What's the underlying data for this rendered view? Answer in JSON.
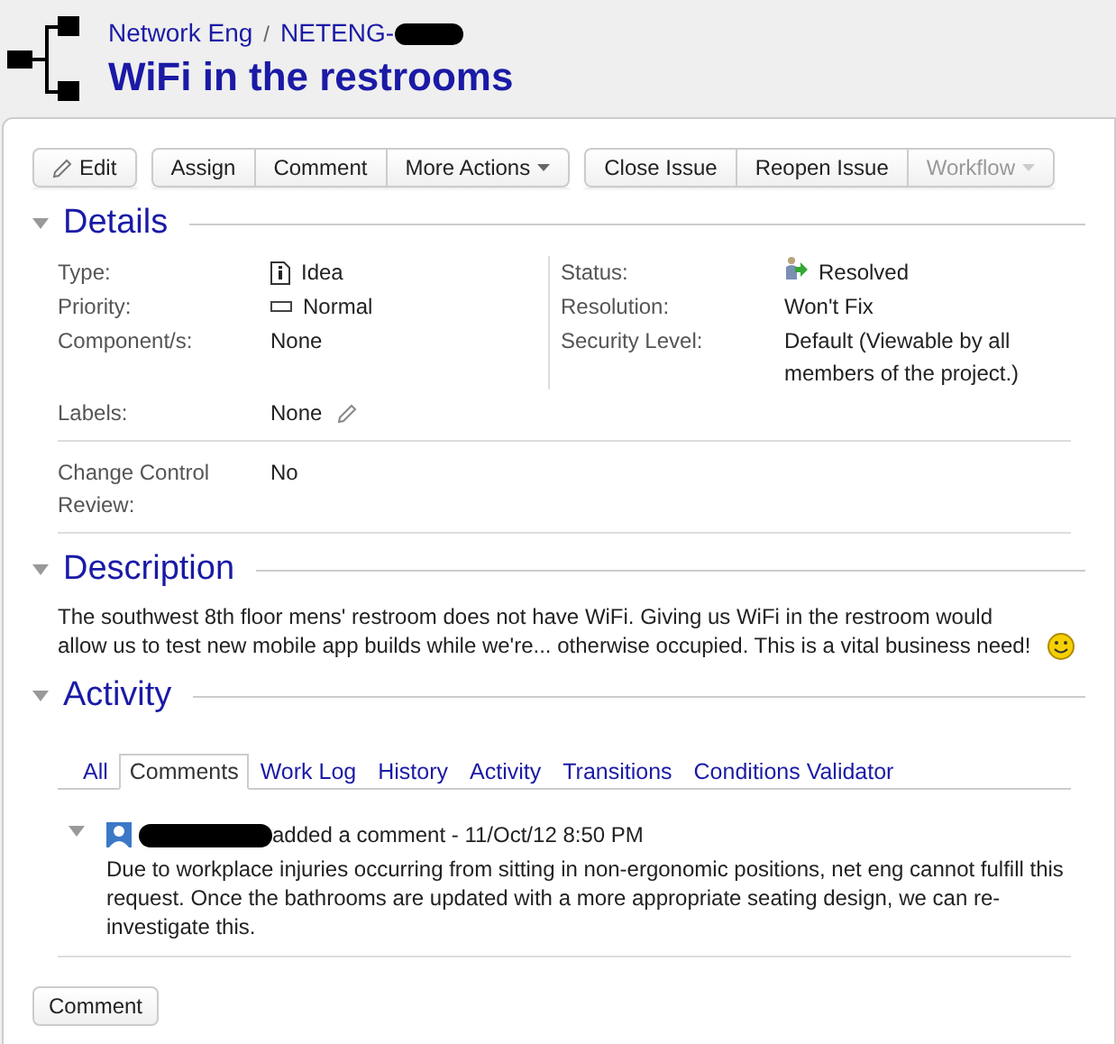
{
  "header": {
    "project": "Network Eng",
    "separator": "/",
    "issue_key": "NETENG-",
    "title": "WiFi in the restrooms"
  },
  "toolbar": [
    {
      "buttons": [
        {
          "label": "Edit",
          "kind": "edit",
          "disabled": false
        }
      ]
    },
    {
      "buttons": [
        {
          "label": "Assign",
          "kind": "plain",
          "disabled": false
        },
        {
          "label": "Comment",
          "kind": "plain",
          "disabled": false
        },
        {
          "label": "More Actions",
          "kind": "dropdown",
          "disabled": false
        }
      ]
    },
    {
      "buttons": [
        {
          "label": "Close Issue",
          "kind": "plain",
          "disabled": false
        },
        {
          "label": "Reopen Issue",
          "kind": "plain",
          "disabled": false
        },
        {
          "label": "Workflow",
          "kind": "dropdown",
          "disabled": true
        }
      ]
    }
  ],
  "details": {
    "title": "Details",
    "expanded": true,
    "left_fields": [
      {
        "label": "Type:",
        "value": "Idea",
        "kind": "idea"
      },
      {
        "label": "Priority:",
        "value": "Normal",
        "kind": "priority"
      },
      {
        "label": "Component/s:",
        "value": "None",
        "kind": "plain"
      }
    ],
    "right_fields": [
      {
        "label": "Status:",
        "value": "Resolved",
        "kind": "status"
      },
      {
        "label": "Resolution:",
        "value": "Won't Fix",
        "kind": "plain"
      },
      {
        "label": "Security Level:",
        "value": "Default (Viewable by all members of the project.)",
        "kind": "plain"
      }
    ],
    "labels": {
      "label": "Labels:",
      "value": "None"
    },
    "custom_fields": [
      {
        "label": "Change Control Review:",
        "value": "No"
      }
    ]
  },
  "description": {
    "title": "Description",
    "expanded": true,
    "text": "The southwest 8th floor mens' restroom does not have WiFi. Giving us WiFi in the restroom would allow us to test new mobile app builds while we're... otherwise occupied. This is a vital business need!"
  },
  "activity": {
    "title": "Activity",
    "expanded": true,
    "tabs": [
      {
        "label": "All",
        "selected": false
      },
      {
        "label": "Comments",
        "selected": true
      },
      {
        "label": "Work Log",
        "selected": false
      },
      {
        "label": "History",
        "selected": false
      },
      {
        "label": "Activity",
        "selected": false
      },
      {
        "label": "Transitions",
        "selected": false
      },
      {
        "label": "Conditions Validator",
        "selected": false
      }
    ],
    "comments": [
      {
        "expanded": true,
        "action": "added a comment - 11/Oct/12 8:50 PM",
        "body": "Due to workplace injuries occurring from sitting in non-ergonomic positions, net eng cannot fulfill this request. Once the bathrooms are updated with a more appropriate seating design, we can re-investigate this."
      }
    ]
  },
  "footer_button": "Comment"
}
